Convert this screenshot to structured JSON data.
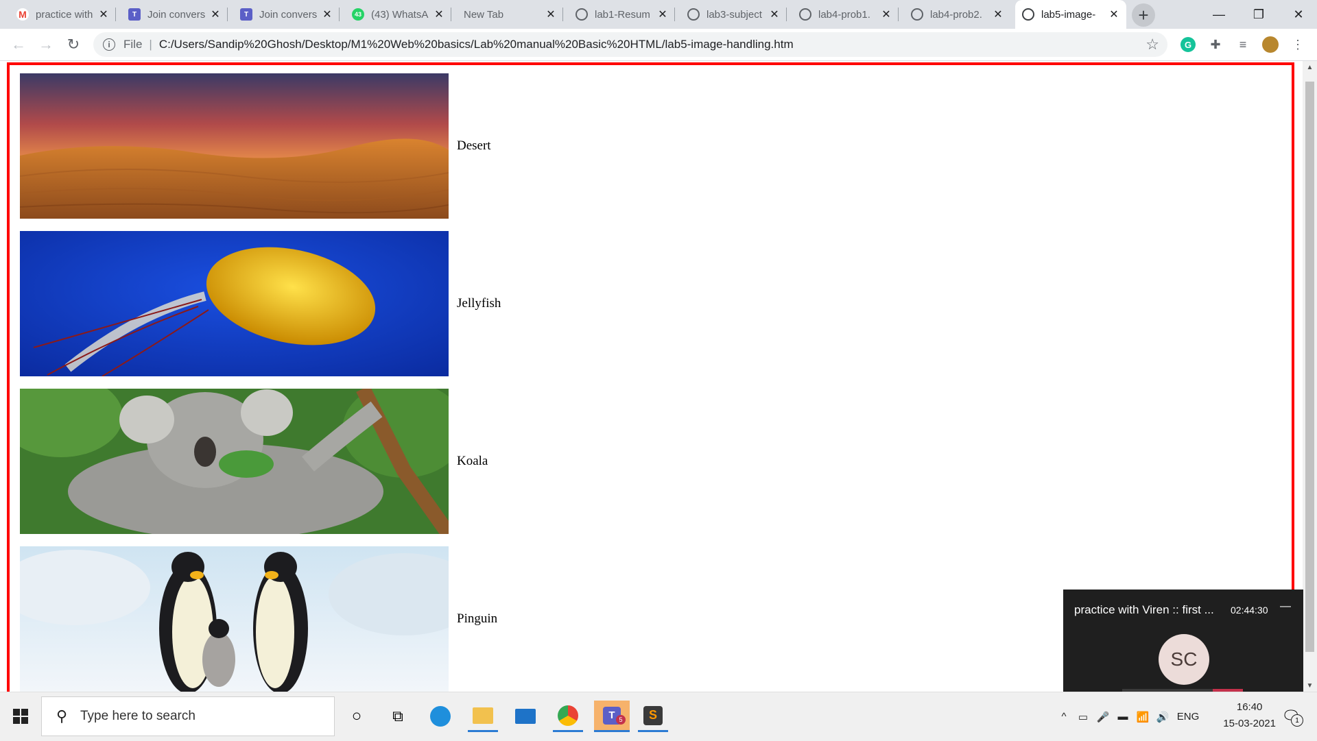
{
  "browser": {
    "tabs": [
      {
        "title": "practice with",
        "icon": "gmail-icon",
        "color": "#ea4335"
      },
      {
        "title": "Join convers",
        "icon": "teams-icon",
        "color": "#5b5fc7"
      },
      {
        "title": "Join convers",
        "icon": "teams-icon",
        "color": "#5b5fc7"
      },
      {
        "title": "(43) WhatsA",
        "icon": "whatsapp-icon",
        "color": "#25d366",
        "badge": "43"
      },
      {
        "title": "New Tab",
        "icon": "",
        "color": ""
      },
      {
        "title": "lab1-Resum",
        "icon": "globe-icon",
        "color": "#5f6368"
      },
      {
        "title": "lab3-subject",
        "icon": "globe-icon",
        "color": "#5f6368"
      },
      {
        "title": "lab4-prob1.",
        "icon": "globe-icon",
        "color": "#5f6368"
      },
      {
        "title": "lab4-prob2.",
        "icon": "globe-icon",
        "color": "#5f6368"
      },
      {
        "title": "lab5-image-",
        "icon": "globe-icon",
        "color": "#5f6368",
        "active": true
      }
    ],
    "address": {
      "scheme_label": "File",
      "url": "C:/Users/Sandip%20Ghosh/Desktop/M1%20Web%20basics/Lab%20manual%20Basic%20HTML/lab5-image-handling.htm"
    }
  },
  "page": {
    "items": [
      {
        "caption": "Desert"
      },
      {
        "caption": "Jellyfish"
      },
      {
        "caption": "Koala"
      },
      {
        "caption": "Pinguin"
      }
    ]
  },
  "taskbar": {
    "search_placeholder": "Type here to search",
    "teams_badge": "5",
    "language": "ENG",
    "time": "16:40",
    "date": "15-03-2021",
    "notification_count": "1"
  },
  "teams_call": {
    "title": "practice with Viren :: first ...",
    "duration": "02:44:30",
    "initials": "SC"
  },
  "colors": {
    "page_border": "#ff0000",
    "call_end": "#c4314b"
  }
}
